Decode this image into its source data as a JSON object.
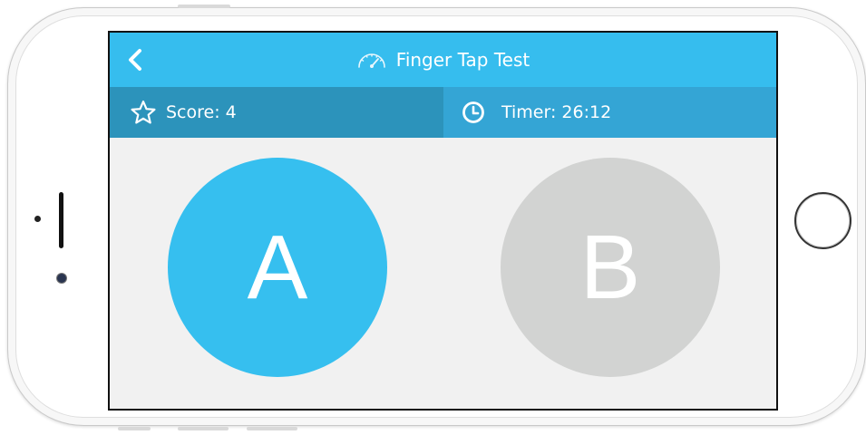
{
  "header": {
    "title": "Finger Tap Test",
    "back_icon": "chevron-left-icon",
    "title_icon": "speedometer-icon"
  },
  "status": {
    "score_label": "Score: 4",
    "score_icon": "star-outline-icon",
    "timer_label": "Timer: 26:12",
    "timer_icon": "clock-icon"
  },
  "buttons": {
    "a_label": "A",
    "b_label": "B"
  },
  "colors": {
    "navbar": "#36bdee",
    "score_bar": "#2c93bb",
    "timer_bar": "#34a5d5",
    "button_active": "#36bfef",
    "button_inactive": "#d2d3d2",
    "background": "#f1f1f1"
  }
}
